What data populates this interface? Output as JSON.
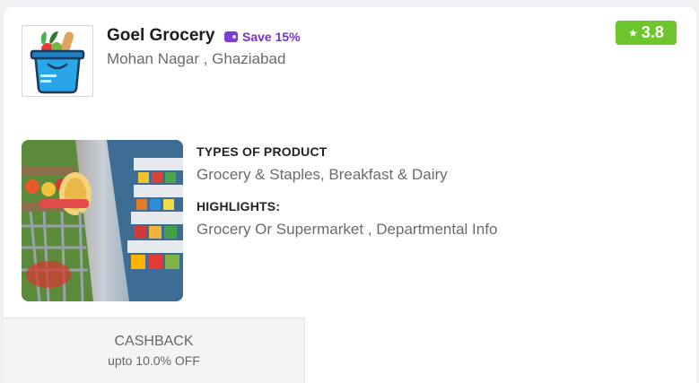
{
  "store": {
    "name": "Goel Grocery",
    "save_label": "Save 15%",
    "location": "Mohan Nagar , Ghaziabad",
    "rating": "3.8",
    "logo_icon": "grocery-bag-icon",
    "photo": "supermarket-aisle-photo"
  },
  "details": {
    "types_heading": "TYPES OF PRODUCT",
    "types_value": "Grocery & Staples, Breakfast & Dairy",
    "highlights_heading": "HIGHLIGHTS:",
    "highlights_value": "Grocery Or Supermarket , Departmental Info"
  },
  "cashback": {
    "title": "CASHBACK",
    "subtitle": "upto 10.0% OFF"
  },
  "colors": {
    "rating_bg": "#6cc62c",
    "save_text": "#7a32c8",
    "card_bg": "#ffffff"
  }
}
